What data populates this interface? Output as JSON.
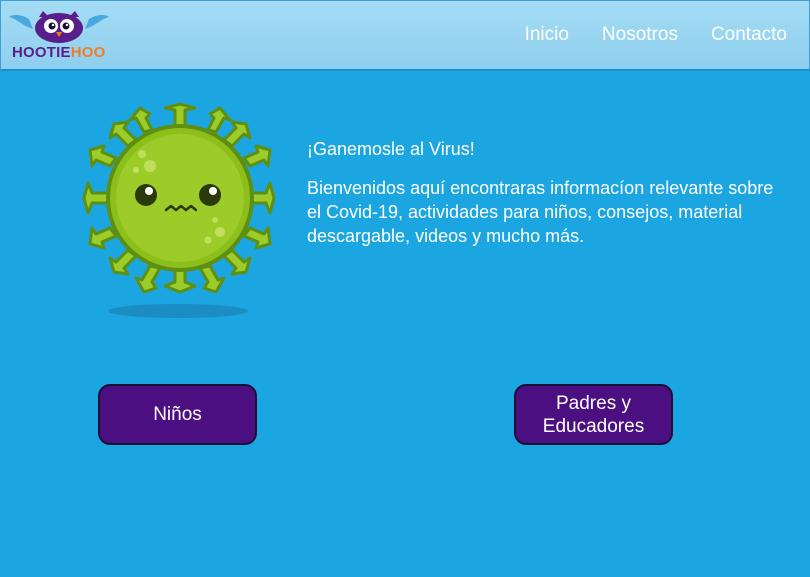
{
  "brand": {
    "name_part1": "HOOTIE",
    "name_part2": "HOO",
    "colors": {
      "purple": "#5a1e8c",
      "orange": "#f47c20"
    }
  },
  "nav": {
    "items": [
      {
        "label": "Inicio"
      },
      {
        "label": "Nosotros"
      },
      {
        "label": "Contacto"
      }
    ]
  },
  "hero": {
    "headline": "¡Ganemosle al Virus!",
    "description": "Bienvenidos aquí encontraras informacíon relevante sobre el Covid-19,  actividades para niños, consejos, material descargable, videos y mucho más.",
    "illustration": "virus-character-icon"
  },
  "buttons": {
    "ninos": "Niños",
    "padres_line1": "Padres y",
    "padres_line2": "Educadores"
  },
  "colors": {
    "background": "#1ba6e2",
    "header": "#a5dcf5",
    "button": "#4c0f82",
    "virus": "#8cbf1a"
  }
}
